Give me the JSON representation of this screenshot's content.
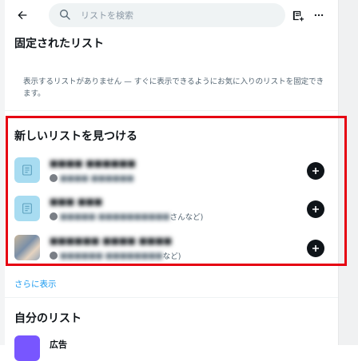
{
  "search": {
    "placeholder": "リストを検索"
  },
  "pinned": {
    "title": "固定されたリスト",
    "empty_message": "表示するリストがありません — すぐに表示できるようにお気に入りのリストを固定できます。"
  },
  "discover": {
    "title": "新しいリストを見つける",
    "items": [
      {
        "name": "■■■■ ■■■■■■",
        "meta_blurred": "■■■■ ■■■■■■",
        "meta_tail": "",
        "thumb": "list-icon"
      },
      {
        "name": "■■■ ■■■",
        "meta_blurred": "■■■■■ ■■■■■■■■■■",
        "meta_tail": "さんなど)",
        "thumb": "list-icon"
      },
      {
        "name": "■■■■■■ ■■■■ ■■■■",
        "meta_blurred": "■■■■■■ ■■■■■■■■",
        "meta_tail": "など)",
        "thumb": "photo"
      }
    ],
    "show_more": "さらに表示"
  },
  "mine": {
    "title": "自分のリスト",
    "items": [
      {
        "name": "広告"
      }
    ]
  },
  "colors": {
    "accent": "#1d9bf0",
    "highlight": "#e60012",
    "list_thumb": "#a8dcf1"
  }
}
